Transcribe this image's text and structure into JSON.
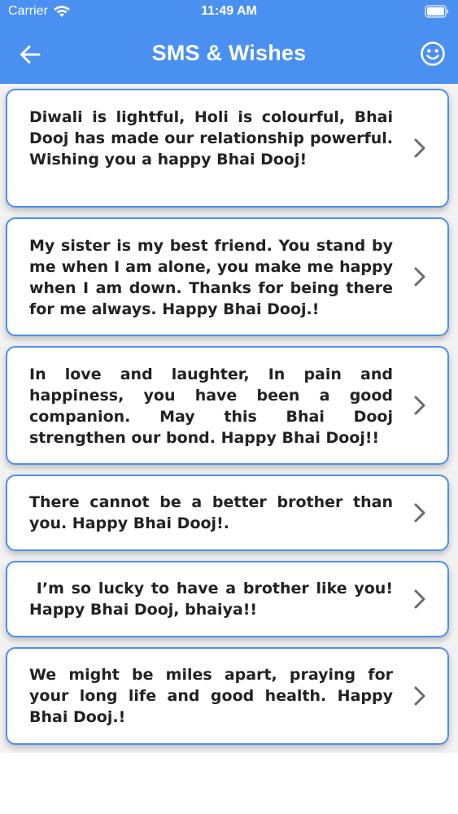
{
  "status_bar": {
    "carrier": "Carrier",
    "time": "11:49 AM"
  },
  "nav": {
    "title": "SMS & Wishes",
    "back_icon": "arrow-left-icon",
    "right_icon": "smiley-icon"
  },
  "colors": {
    "accent": "#4a90f0",
    "card_border": "#4a90f0",
    "text": "#222222",
    "chevron": "#6b6b6b",
    "background": "#f2f2f2"
  },
  "messages": [
    {
      "text": "Diwali is lightful, Holi is colourful, Bhai Dooj has made our relationship powerful. Wishing you a happy Bhai Dooj!"
    },
    {
      "text": "My sister is my best friend. You stand by me when I am alone, you make me happy when I am down. Thanks for being there for me always. Happy Bhai Dooj.!"
    },
    {
      "text": "In love and laughter, In pain and happiness, you have been a good companion. May this Bhai Dooj strengthen our bond. Happy Bhai Dooj!!"
    },
    {
      "text": "There cannot be a better brother than you. Happy Bhai Dooj!."
    },
    {
      "text": " I’m so lucky to have a brother like you! Happy Bhai Dooj, bhaiya!!"
    },
    {
      "text": "We might be miles apart, praying for your long life and good health. Happy Bhai Dooj.!"
    }
  ]
}
